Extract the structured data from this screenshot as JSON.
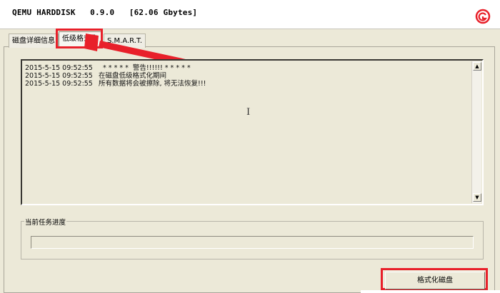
{
  "header": {
    "title": "QEMU HARDDISK   0.9.0   [62.06 Gbytes]",
    "logo_icon": "brand-logo-icon"
  },
  "tabs": [
    {
      "label": "磁盘详细信息",
      "active": false
    },
    {
      "label": "低级格式化",
      "active": true
    },
    {
      "label": "S.M.A.R.T.",
      "active": false
    }
  ],
  "log": {
    "lines": [
      {
        "time": "2015-5-15 09:52:55",
        "message": "  * * * * *  警告!!!!!! * * * * *"
      },
      {
        "time": "2015-5-15 09:52:55",
        "message": "在磁盘低级格式化期间"
      },
      {
        "time": "2015-5-15 09:52:55",
        "message": "所有数据将会被擦除, 将无法恢复!!!"
      }
    ]
  },
  "progress": {
    "label": "当前任务进度",
    "value": 0
  },
  "actions": {
    "format_label": "格式化磁盘"
  },
  "colors": {
    "annotation": "#e8202a",
    "window_bg": "#ece9d8",
    "progress_fill": "#316ac5"
  }
}
